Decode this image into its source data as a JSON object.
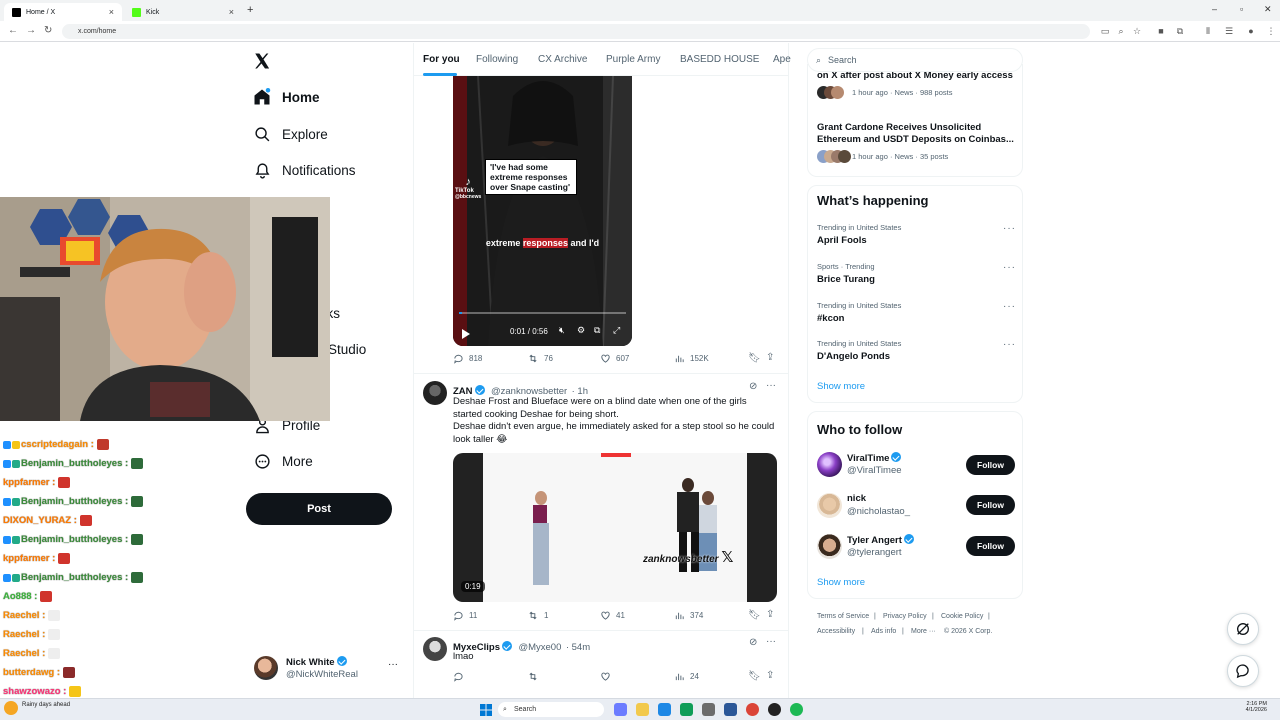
{
  "browser": {
    "tabs": [
      {
        "title": "Home / X",
        "active": true
      },
      {
        "title": "Kick",
        "active": false
      }
    ],
    "url": "x.com/home"
  },
  "nav": {
    "items": [
      {
        "label": "Home"
      },
      {
        "label": "Explore"
      },
      {
        "label": "Notifications"
      },
      {
        "label": "n"
      },
      {
        "label": "rks"
      },
      {
        "label": "Studio"
      },
      {
        "label": "Profile"
      },
      {
        "label": "More"
      }
    ],
    "post_label": "Post",
    "account": {
      "name": "Nick White",
      "handle": "@NickWhiteReal"
    }
  },
  "chat": [
    {
      "name": "cscriptedagain :",
      "color": "#ff8c00"
    },
    {
      "name": "Benjamin_buttholeyes :",
      "color": "#3b8c3b"
    },
    {
      "name": "kppfarmer :",
      "color": "#ff7a00"
    },
    {
      "name": "Benjamin_buttholeyes :",
      "color": "#3b8c3b"
    },
    {
      "name": "DIXON_YURAZ :",
      "color": "#ff7a00"
    },
    {
      "name": "Benjamin_buttholeyes :",
      "color": "#3b8c3b"
    },
    {
      "name": "kppfarmer :",
      "color": "#ff7a00"
    },
    {
      "name": "Benjamin_buttholeyes :",
      "color": "#3b8c3b"
    },
    {
      "name": "Ao888 :",
      "color": "#3bb33b"
    },
    {
      "name": "Raechel :",
      "color": "#ff8c00"
    },
    {
      "name": "Raechel :",
      "color": "#ff8c00"
    },
    {
      "name": "Raechel :",
      "color": "#ff8c00"
    },
    {
      "name": "butterdawg :",
      "color": "#ff8c00"
    },
    {
      "name": "shawzowazo :",
      "color": "#ff3377"
    }
  ],
  "feed": {
    "tabs": [
      "For you",
      "Following",
      "CX Archive",
      "Purple Army",
      "BASEDD HOUSE",
      "Ape"
    ],
    "video1": {
      "caption_box": "'I've had some extreme responses over Snape casting'",
      "subtitle_a": "extreme ",
      "subtitle_b": "responses",
      "subtitle_c": " and I'd",
      "tiktok_label": "TikTok",
      "tiktok_handle": "@bbcnews",
      "time": "0:01 / 0:56",
      "progress": 0.02
    },
    "tweet1_stats": {
      "replies": "818",
      "reposts": "76",
      "likes": "607",
      "views": "152K"
    },
    "tweet2": {
      "name": "ZAN",
      "handle": "@zanknowsbetter",
      "time": "· 1h",
      "text_line1": "Deshae Frost and Blueface were on a blind date when one of the girls started cooking Deshae for being short.",
      "text_line2": "Deshae didn't even argue, he immediately asked for a step stool so he could look taller 😂",
      "video_duration": "0:19",
      "watermark": "zanknowsbetter",
      "stats": {
        "replies": "11",
        "reposts": "1",
        "likes": "41",
        "views": "374"
      }
    },
    "tweet3": {
      "name": "MyxeClips",
      "handle": "@Myxe00",
      "time": "· 54m",
      "text": "lmao",
      "stats": {
        "views": "24"
      }
    }
  },
  "right": {
    "search_placeholder": "Search",
    "news": [
      {
        "title": "on X after post about X Money early access",
        "meta": "1 hour ago · News · 988 posts"
      },
      {
        "title": "Grant Cardone Receives Unsolicited Ethereum and USDT Deposits on Coinbas...",
        "meta": "1 hour ago · News · 35 posts"
      }
    ],
    "happening_title": "What’s happening",
    "trends": [
      {
        "meta": "Trending in United States",
        "name": "April Fools"
      },
      {
        "meta": "Sports · Trending",
        "name": "Brice Turang"
      },
      {
        "meta": "Trending in United States",
        "name": "#kcon"
      },
      {
        "meta": "Trending in United States",
        "name": "D'Angelo Ponds"
      }
    ],
    "show_more": "Show more",
    "who_title": "Who to follow",
    "who": [
      {
        "name": "ViralTime",
        "handle": "@ViralTimee",
        "verified": true
      },
      {
        "name": "nick",
        "handle": "@nicholastao_",
        "verified": false
      },
      {
        "name": "Tyler Angert",
        "handle": "@tylerangert",
        "verified": true
      }
    ],
    "follow_label": "Follow",
    "footer": [
      "Terms of Service",
      "|",
      "Privacy Policy",
      "|",
      "Cookie Policy",
      "|",
      "Accessibility",
      "|",
      "Ads info",
      "|",
      "More ···",
      "© 2026 X Corp."
    ]
  },
  "taskbar": {
    "weather": "Rainy days ahead",
    "search": "Search",
    "time": "2:16 PM",
    "date": "4/1/2026"
  }
}
